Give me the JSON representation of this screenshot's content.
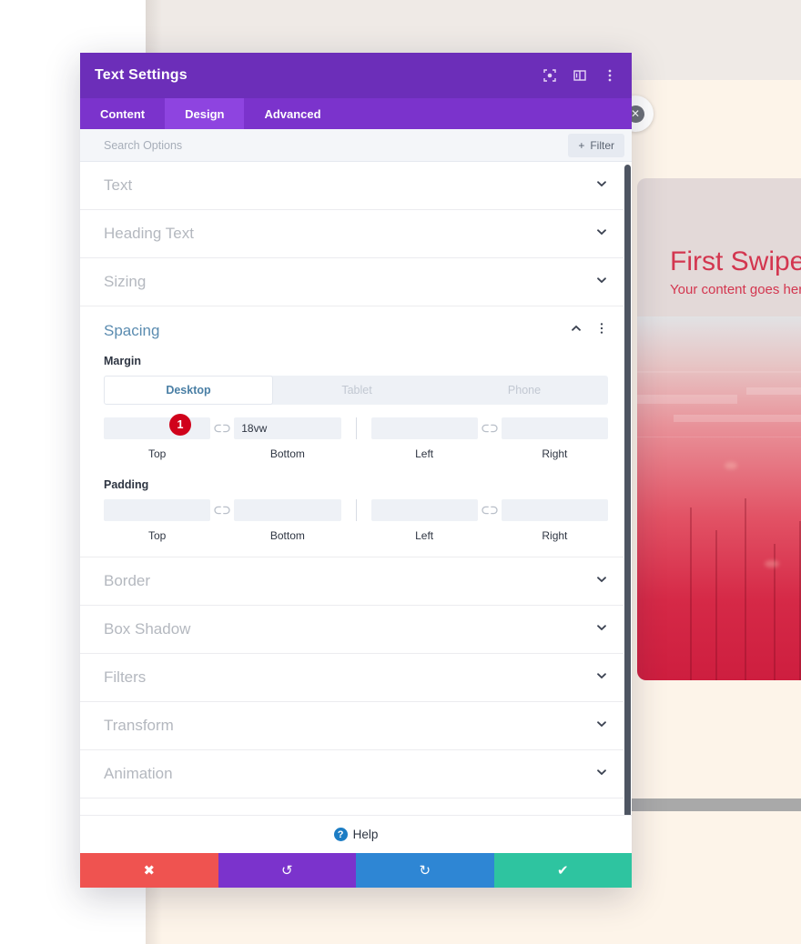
{
  "modal": {
    "title": "Text Settings",
    "header_icons": [
      {
        "name": "focus-icon",
        "glyph": "focus"
      },
      {
        "name": "split-view-icon",
        "glyph": "columns"
      },
      {
        "name": "more-options-icon",
        "glyph": "kebab"
      }
    ],
    "tabs": [
      {
        "label": "Content",
        "active": false
      },
      {
        "label": "Design",
        "active": true
      },
      {
        "label": "Advanced",
        "active": false
      }
    ],
    "search": {
      "placeholder": "Search Options",
      "value": "",
      "filter_label": "Filter",
      "filter_plus": "+"
    },
    "sections_before": [
      {
        "label": "Text"
      },
      {
        "label": "Heading Text"
      },
      {
        "label": "Sizing"
      }
    ],
    "spacing": {
      "title": "Spacing",
      "margin_label": "Margin",
      "padding_label": "Padding",
      "devices": [
        {
          "label": "Desktop",
          "active": true
        },
        {
          "label": "Tablet",
          "active": false
        },
        {
          "label": "Phone",
          "active": false
        }
      ],
      "badge": "1",
      "margin": {
        "top": {
          "label": "Top",
          "value": "",
          "placeholder": ""
        },
        "bottom": {
          "label": "Bottom",
          "value": "18vw",
          "placeholder": ""
        },
        "left": {
          "label": "Left",
          "value": "",
          "placeholder": ""
        },
        "right": {
          "label": "Right",
          "value": "",
          "placeholder": ""
        }
      },
      "padding": {
        "top": {
          "label": "Top",
          "value": "",
          "placeholder": ""
        },
        "bottom": {
          "label": "Bottom",
          "value": "",
          "placeholder": ""
        },
        "left": {
          "label": "Left",
          "value": "",
          "placeholder": ""
        },
        "right": {
          "label": "Right",
          "value": "",
          "placeholder": ""
        }
      }
    },
    "sections_after": [
      {
        "label": "Border"
      },
      {
        "label": "Box Shadow"
      },
      {
        "label": "Filters"
      },
      {
        "label": "Transform"
      },
      {
        "label": "Animation"
      }
    ],
    "help": {
      "label": "Help",
      "icon_char": "?"
    },
    "footer_buttons": [
      {
        "name": "cancel-button",
        "icon": "✖",
        "color": "#ef5350"
      },
      {
        "name": "undo-button",
        "icon": "↺",
        "color": "#7b33cc"
      },
      {
        "name": "redo-button",
        "icon": "↻",
        "color": "#2e86d4"
      },
      {
        "name": "save-button",
        "icon": "✔",
        "color": "#2ec4a0"
      }
    ]
  },
  "background": {
    "card_title": "First Swipe",
    "card_subtitle": "Your content goes here",
    "close_badge_icon": "✕"
  },
  "colors": {
    "header_purple": "#6c2eb9",
    "tab_bar_purple": "#7b33cc",
    "tab_active_purple": "#8e44e0",
    "section_title_blue": "#5b8cb0",
    "badge_red": "#d0021b",
    "card_text_red": "#d3364f",
    "cream": "#fdf4e9"
  }
}
